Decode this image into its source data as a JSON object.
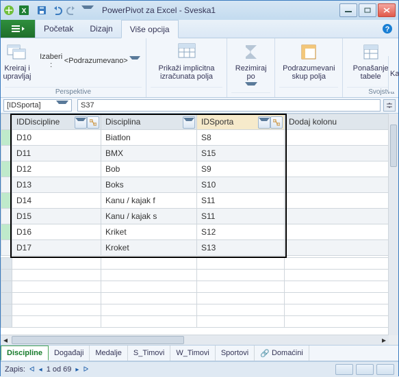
{
  "title": "PowerPivot za Excel - Sveska1",
  "menu": {
    "file_glyph": "▾",
    "tabs": [
      "Početak",
      "Dizajn",
      "Više opcija"
    ],
    "active": 2,
    "help": "?"
  },
  "ribbon": {
    "g1": {
      "btn": "Kreiraj i\nupravljaj",
      "izaberi_lbl": "Izaberi :",
      "izaberi_val": "<Podrazumevano>",
      "group": "Perspektive"
    },
    "g2": {
      "btn": "Prikaži implicitna\nizračunata polja"
    },
    "g3": {
      "btn": "Rezimiraj\npo"
    },
    "g4": {
      "btn": "Podrazumevani\nskup polja"
    },
    "g5": {
      "btn": "Ponašanje\ntabele",
      "group": "Svojstva"
    },
    "cut": "Kate"
  },
  "formula": {
    "name": "[IDSporta]",
    "value": "S37"
  },
  "columns": [
    "IDDiscipline",
    "Disciplina",
    "IDSporta",
    "Dodaj kolonu"
  ],
  "rows": [
    {
      "id": "D10",
      "d": "Biatlon",
      "s": "S8"
    },
    {
      "id": "D11",
      "d": "BMX",
      "s": "S15"
    },
    {
      "id": "D12",
      "d": "Bob",
      "s": "S9"
    },
    {
      "id": "D13",
      "d": "Boks",
      "s": "S10"
    },
    {
      "id": "D14",
      "d": "Kanu / kajak f",
      "s": "S11"
    },
    {
      "id": "D15",
      "d": "Kanu / kajak s",
      "s": "S11"
    },
    {
      "id": "D16",
      "d": "Kriket",
      "s": "S12"
    },
    {
      "id": "D17",
      "d": "Kroket",
      "s": "S13"
    }
  ],
  "sheets": {
    "items": [
      "Discipline",
      "Događaji",
      "Medalje",
      "S_Timovi",
      "W_Timovi",
      "Sportovi",
      "Domaćini"
    ],
    "active": 0,
    "linked": 6
  },
  "status": {
    "label": "Zapis:",
    "pos": "1 od 69"
  }
}
